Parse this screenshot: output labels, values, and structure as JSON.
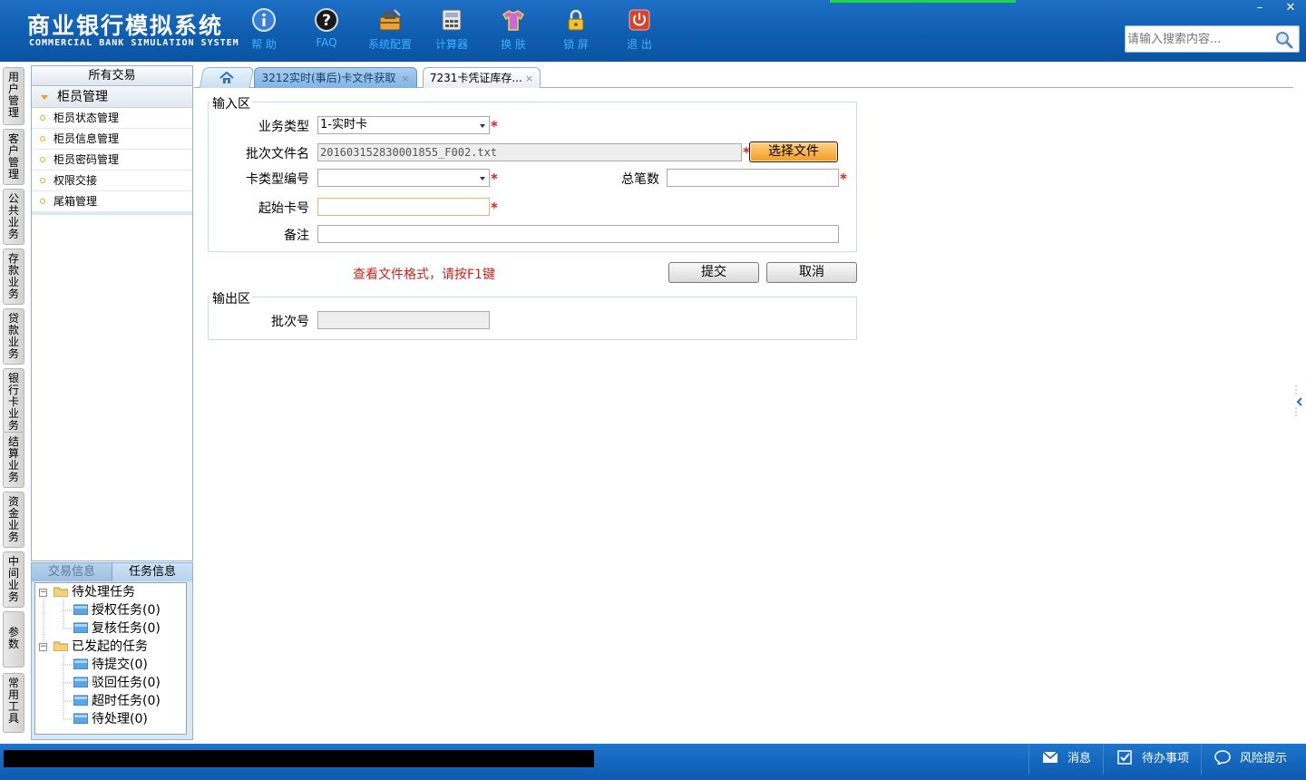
{
  "header": {
    "title_cn": "商业银行模拟系统",
    "title_en": "COMMERCIAL BANK SIMULATION SYSTEM",
    "toolbar": [
      {
        "label": "帮 助",
        "icon": "info-icon"
      },
      {
        "label": "FAQ",
        "icon": "question-icon"
      },
      {
        "label": "系统配置",
        "icon": "toolbox-icon"
      },
      {
        "label": "计算器",
        "icon": "calculator-icon"
      },
      {
        "label": "换 肤",
        "icon": "tshirt-icon"
      },
      {
        "label": "锁 屏",
        "icon": "lock-icon"
      },
      {
        "label": "退 出",
        "icon": "power-icon"
      }
    ],
    "window_controls": {
      "minimize": "–",
      "close": "✕"
    },
    "search": {
      "placeholder": "请输入搜索内容...",
      "value": ""
    }
  },
  "vertical_tabs": [
    "用户管理",
    "客户管理",
    "公共业务",
    "存款业务",
    "贷款业务",
    "银行卡业务",
    "结算业务",
    "资金业务",
    "中间业务",
    "参数",
    "常用工具"
  ],
  "nav": {
    "header": "所有交易",
    "group": "柜员管理",
    "items": [
      "柜员状态管理",
      "柜员信息管理",
      "柜员密码管理",
      "权限交接",
      "尾箱管理"
    ]
  },
  "task_panel": {
    "tabs": [
      "交易信息",
      "任务信息"
    ],
    "tree": {
      "pending": {
        "label": "待处理任务",
        "children": [
          "授权任务(0)",
          "复核任务(0)"
        ]
      },
      "initiated": {
        "label": "已发起的任务",
        "children": [
          "待提交(0)",
          "驳回任务(0)",
          "超时任务(0)",
          "待处理(0)"
        ]
      }
    }
  },
  "tabs": {
    "active": "3212实时(事后)卡文件获取",
    "second": "7231卡凭证库存...",
    "close_glyph": "×"
  },
  "form": {
    "input_legend": "输入区",
    "business_type": {
      "label": "业务类型",
      "value": "1-实时卡"
    },
    "batch_file": {
      "label": "批次文件名",
      "value": "201603152830001855_F002.txt",
      "button": "选择文件"
    },
    "card_type_code": {
      "label": "卡类型编号",
      "value": ""
    },
    "total_count": {
      "label": "总笔数",
      "value": ""
    },
    "start_card_no": {
      "label": "起始卡号",
      "value": ""
    },
    "remark": {
      "label": "备注",
      "value": ""
    },
    "required_mark": "*",
    "hint": "查看文件格式，请按F1键",
    "submit": "提交",
    "cancel": "取消",
    "output_legend": "输出区",
    "batch_no": {
      "label": "批次号",
      "value": ""
    }
  },
  "statusbar": {
    "messages": "消息",
    "todo": "待办事项",
    "risk": "风险提示"
  },
  "colors": {
    "header_blue": "#0f5cae",
    "toolbar_label": "#3fb0ff",
    "required_red": "#e02020",
    "hint_red": "#c8221c",
    "choose_file_orange": "#f39c1f"
  }
}
